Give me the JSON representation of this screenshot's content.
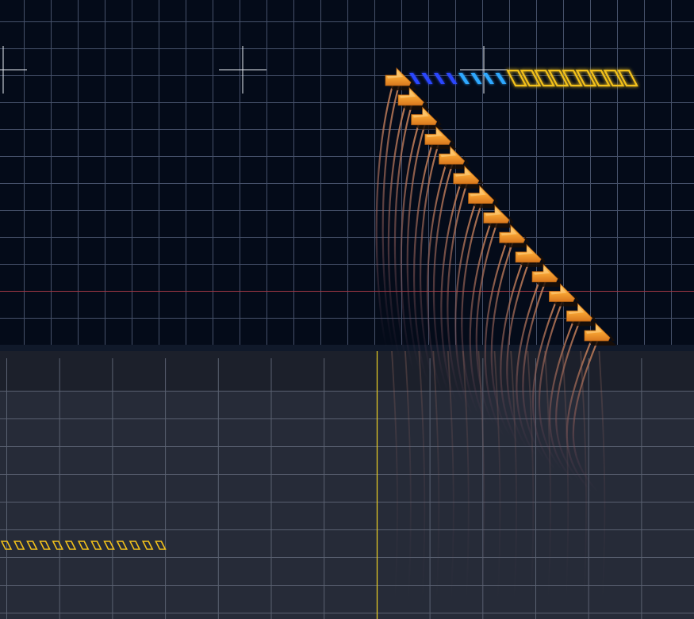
{
  "colors": {
    "upper_background": "#040b19",
    "upper_grid": "#46516a",
    "boundary_line": "#a03844",
    "divider": "#10192a",
    "lower_background": "#262b38",
    "lower_header": "#1c202b",
    "lower_grid": "#5a6171",
    "playhead": "#e8cc22",
    "note_orange": "#f7a433",
    "note_highlight": "#ffd58a",
    "note_shadow": "#1a0e06",
    "trail": "#c07a52",
    "slide_blue_dark": "#2b46ff",
    "slide_blue_light": "#2fa8ff",
    "slide_gold": "#f3c11a",
    "crosshair": "#e8ecf4"
  },
  "staircase": {
    "note_count": 14,
    "icon": "arrow-note-icon"
  },
  "slide_track": {
    "blue_segments": 8,
    "gold_segments": 9,
    "icon": "slide-chain-icon"
  },
  "timeline": {
    "marker_count": 13,
    "icon": "diamond-marker-icon"
  }
}
